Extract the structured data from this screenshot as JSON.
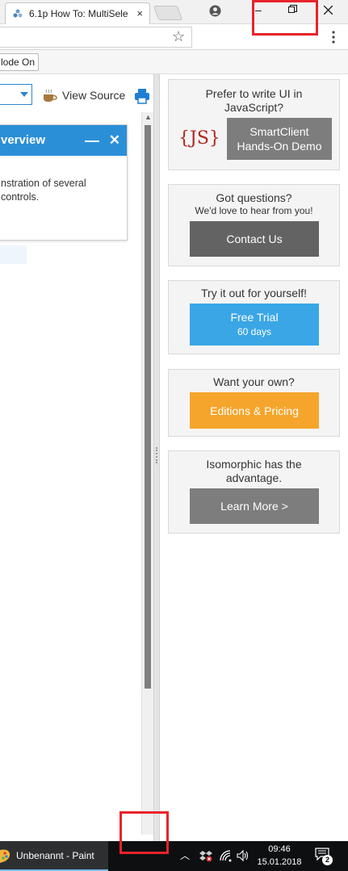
{
  "browser": {
    "tab_title": "6.1p How To: MultiSele",
    "tab_close": "×",
    "bookmark_label": "lode On"
  },
  "page": {
    "view_source_label": "View Source",
    "window_title": "verview",
    "window_text_line1": "nstration of several",
    "window_text_line2": "controls."
  },
  "promos": {
    "js_heading": "Prefer to write UI in JavaScript?",
    "js_logo": "{JS}",
    "js_button_line1": "SmartClient",
    "js_button_line2": "Hands-On Demo",
    "questions_heading": "Got questions?",
    "questions_sub": "We'd love to hear from you!",
    "contact_button": "Contact Us",
    "trial_heading": "Try it out for yourself!",
    "trial_button_line1": "Free Trial",
    "trial_button_line2": "60 days",
    "editions_heading": "Want your own?",
    "editions_button": "Editions & Pricing",
    "iso_heading_line1": "Isomorphic has the",
    "iso_heading_line2": "advantage.",
    "learn_button": "Learn More >"
  },
  "taskbar": {
    "app_label": "Unbenannt - Paint",
    "time": "09:46",
    "date": "15.01.2018",
    "notification_count": "2"
  },
  "colors": {
    "accent_blue": "#2b8fd8",
    "trial_blue": "#3aa6e6",
    "editions_orange": "#f6a52c",
    "dark_gray_button": "#636363",
    "gray_button": "#7d7d7d",
    "annotation_red": "#e8232b"
  }
}
